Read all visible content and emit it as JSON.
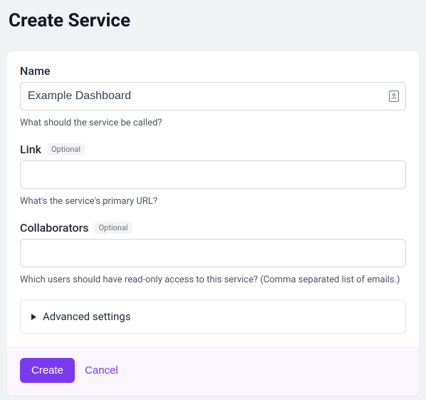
{
  "header": {
    "title": "Create Service"
  },
  "form": {
    "name": {
      "label": "Name",
      "value": "Example Dashboard",
      "help": "What should the service be called?"
    },
    "link": {
      "label": "Link",
      "optional": "Optional",
      "value": "",
      "help": "What's the service's primary URL?"
    },
    "collaborators": {
      "label": "Collaborators",
      "optional": "Optional",
      "value": "",
      "help": "Which users should have read-only access to this service? (Comma separated list of emails.)"
    },
    "advanced": {
      "label": "Advanced settings"
    }
  },
  "actions": {
    "create": "Create",
    "cancel": "Cancel"
  }
}
